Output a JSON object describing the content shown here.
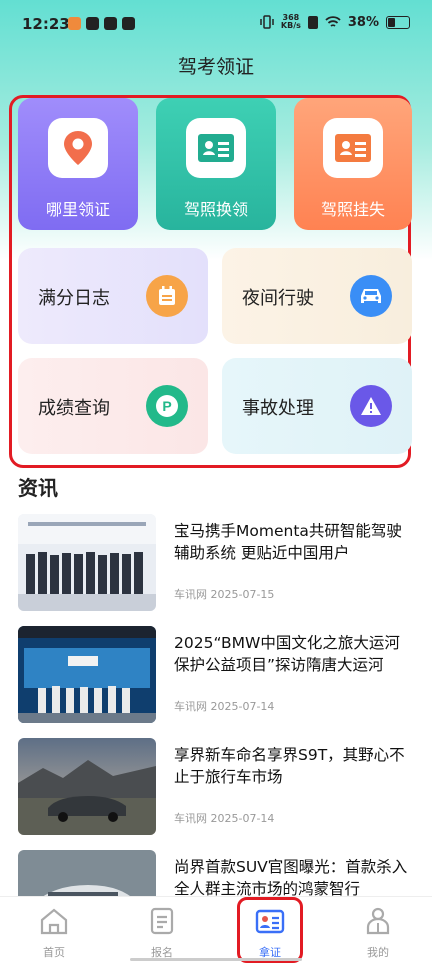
{
  "status": {
    "time": "12:23",
    "speed_top": "368",
    "speed_bottom": "KB/s",
    "battery": "38%"
  },
  "header": {
    "title": "驾考领证"
  },
  "big_cards": [
    {
      "label": "哪里领证",
      "icon": "location-pin-icon"
    },
    {
      "label": "驾照换领",
      "icon": "id-card-icon"
    },
    {
      "label": "驾照挂失",
      "icon": "id-card-icon"
    }
  ],
  "small_cards": [
    {
      "label": "满分日志",
      "icon": "calendar-icon"
    },
    {
      "label": "夜间行驶",
      "icon": "car-icon"
    },
    {
      "label": "成绩查询",
      "icon": "parking-icon"
    },
    {
      "label": "事故处理",
      "icon": "warning-icon"
    }
  ],
  "colors": {
    "accent": "#3a6ff7",
    "highlight": "#e21b23"
  },
  "news": {
    "heading": "资讯",
    "items": [
      {
        "title": "宝马携手Momenta共研智能驾驶辅助系统 更贴近中国用户",
        "source": "车讯网",
        "date": "2025-07-15"
      },
      {
        "title": "2025“BMW中国文化之旅大运河保护公益项目”探访隋唐大运河",
        "source": "车讯网",
        "date": "2025-07-14"
      },
      {
        "title": "享界新车命名享界S9T，其野心不止于旅行车市场",
        "source": "车讯网",
        "date": "2025-07-14"
      },
      {
        "title": "尚界首款SUV官图曝光：首款杀入全人群主流市场的鸿蒙智行",
        "source": "",
        "date": ""
      }
    ]
  },
  "tabs": [
    {
      "label": "首页"
    },
    {
      "label": "报名"
    },
    {
      "label": "拿证"
    },
    {
      "label": "我的"
    }
  ]
}
